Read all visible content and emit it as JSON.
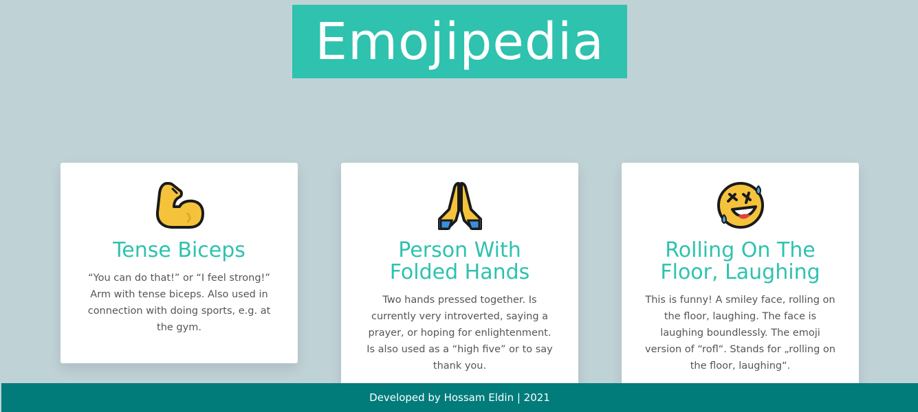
{
  "header": {
    "title": "Emojipedia"
  },
  "cards": [
    {
      "emoji": "flexed-biceps-icon",
      "title": "Tense Biceps",
      "description": "“You can do that!” or “I feel strong!” Arm with tense biceps. Also used in connection with doing sports, e.g. at the gym."
    },
    {
      "emoji": "folded-hands-icon",
      "title": "Person With Folded Hands",
      "description": "Two hands pressed together. Is currently very introverted, saying a prayer, or hoping for enlightenment. Is also used as a “high five” or to say thank you."
    },
    {
      "emoji": "rolling-on-floor-laughing-icon",
      "title": "Rolling On The Floor, Laughing",
      "description": "This is funny! A smiley face, rolling on the floor, laughing. The face is laughing boundlessly. The emoji version of “rofl“. Stands for „rolling on the floor, laughing“."
    }
  ],
  "footer": {
    "text": "Developed by Hossam Eldin | 2021"
  },
  "colors": {
    "background": "#bfd2d6",
    "accent": "#2ec2af",
    "footer": "#027b7b"
  }
}
